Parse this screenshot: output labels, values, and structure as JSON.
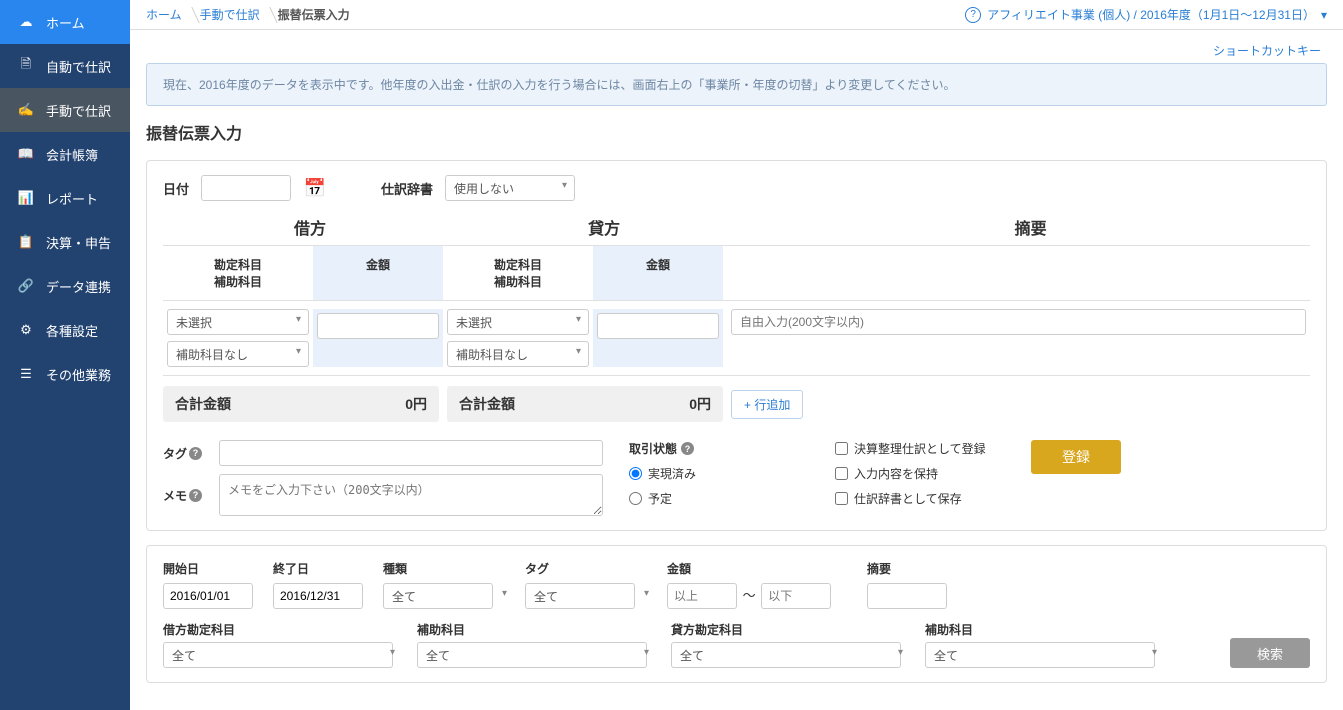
{
  "sidebar": {
    "items": [
      {
        "label": "ホーム"
      },
      {
        "label": "自動で仕訳"
      },
      {
        "label": "手動で仕訳"
      },
      {
        "label": "会計帳簿"
      },
      {
        "label": "レポート"
      },
      {
        "label": "決算・申告"
      },
      {
        "label": "データ連携"
      },
      {
        "label": "各種設定"
      },
      {
        "label": "その他業務"
      }
    ]
  },
  "breadcrumb": {
    "items": [
      "ホーム",
      "手動で仕訳",
      "振替伝票入力"
    ]
  },
  "header": {
    "context": "アフィリエイト事業 (個人) / 2016年度（1月1日～12月31日）"
  },
  "shortcut": "ショートカットキー",
  "info_box": "現在、2016年度のデータを表示中です。他年度の入出金・仕訳の入力を行う場合には、画面右上の「事業所・年度の切替」より変更してください。",
  "title": "振替伝票入力",
  "date_label": "日付",
  "dict_label": "仕訳辞書",
  "dict_value": "使用しない",
  "columns": {
    "debit": "借方",
    "credit": "貸方",
    "memo": "摘要",
    "acc": "勘定科目",
    "aux": "補助科目",
    "amt": "金額"
  },
  "acc_placeholder": "未選択",
  "aux_placeholder": "補助科目なし",
  "memo_placeholder": "自由入力(200文字以内)",
  "total_label": "合計金額",
  "total_debit": "0円",
  "total_credit": "0円",
  "add_row": "+ 行追加",
  "tag_label": "タグ",
  "memo_label": "メモ",
  "memo_pl": "メモをご入力下さい（200文字以内）",
  "status_label": "取引状態",
  "status_done": "実現済み",
  "status_future": "予定",
  "chk_settle": "決算整理仕訳として登録",
  "chk_keep": "入力内容を保持",
  "chk_savedic": "仕訳辞書として保存",
  "register": "登録",
  "search": {
    "start_l": "開始日",
    "start_v": "2016/01/01",
    "end_l": "終了日",
    "end_v": "2016/12/31",
    "type_l": "種類",
    "all": "全て",
    "tag_l": "タグ",
    "amt_l": "金額",
    "ge": "以上",
    "le": "以下",
    "memo_l": "摘要",
    "debit_acc_l": "借方勘定科目",
    "aux_l": "補助科目",
    "credit_acc_l": "貸方勘定科目",
    "btn": "検索"
  }
}
